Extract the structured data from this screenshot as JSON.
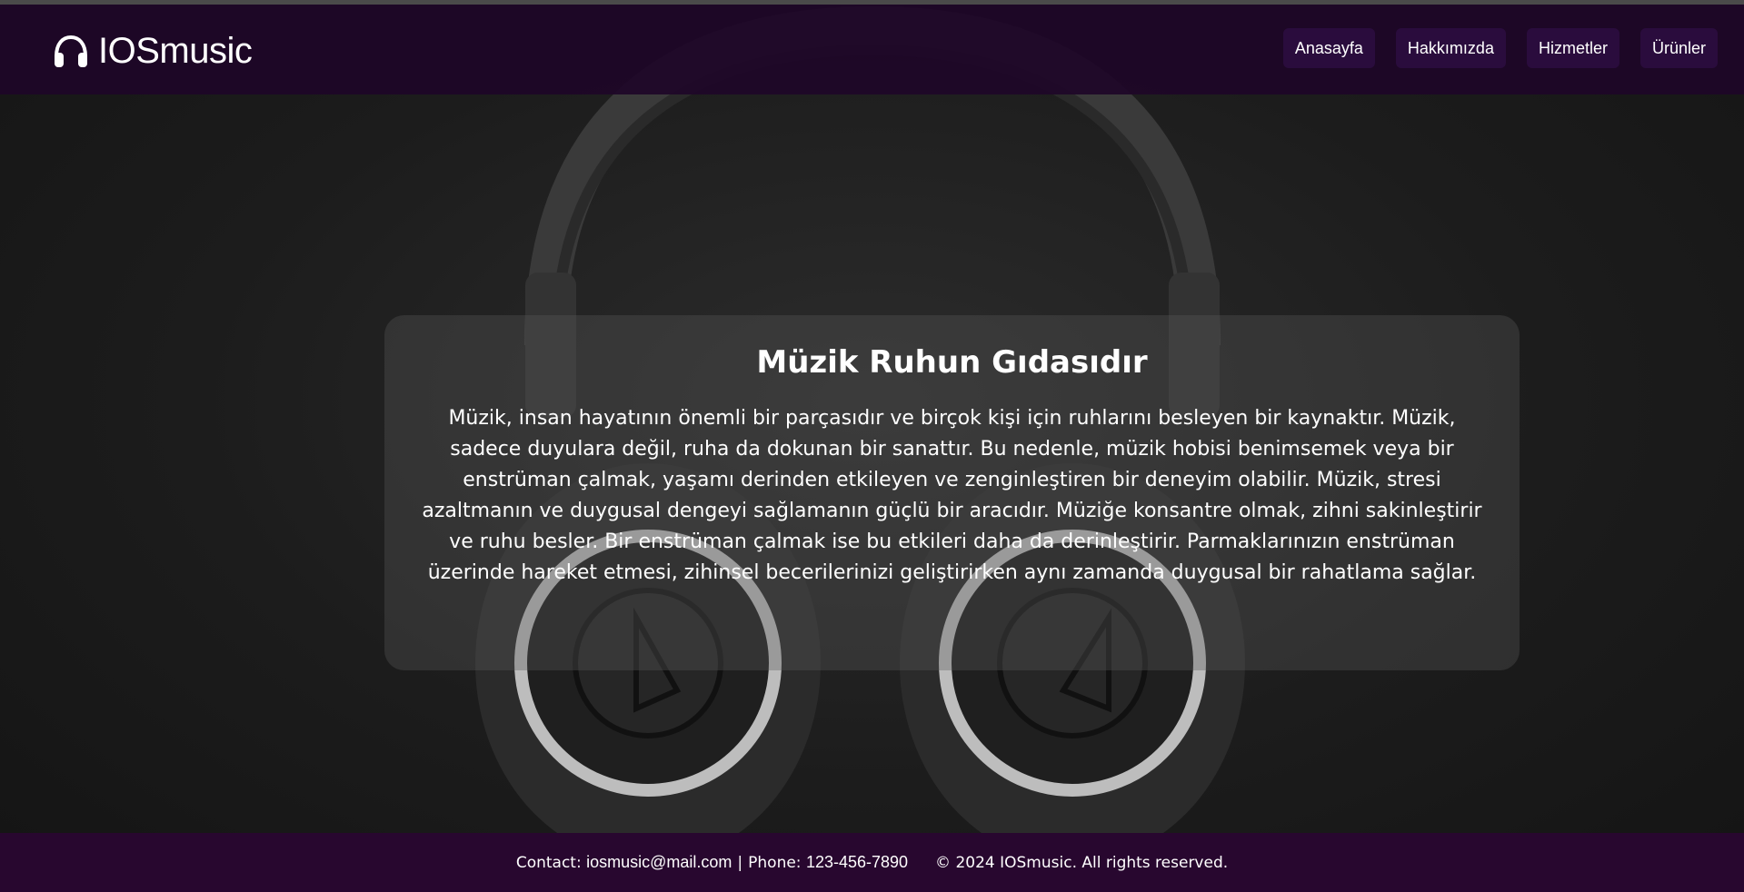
{
  "header": {
    "logo_text": "IOSmusic",
    "logo_icon": "headphones-icon",
    "nav": [
      {
        "label": "Anasayfa"
      },
      {
        "label": "Hakkımızda"
      },
      {
        "label": "Hizmetler"
      },
      {
        "label": "Ürünler"
      }
    ]
  },
  "hero": {
    "title": "Müzik Ruhun Gıdasıdır",
    "body": "Müzik, insan hayatının önemli bir parçasıdır ve birçok kişi için ruhlarını besleyen bir kaynaktır. Müzik, sadece duyulara değil, ruha da dokunan bir sanattır. Bu nedenle, müzik hobisi benimsemek veya bir enstrüman çalmak, yaşamı derinden etkileyen ve zenginleştiren bir deneyim olabilir. Müzik, stresi azaltmanın ve duygusal dengeyi sağlamanın güçlü bir aracıdır. Müziğe konsantre olmak, zihni sakinleştirir ve ruhu besler. Bir enstrüman çalmak ise bu etkileri daha da derinleştirir. Parmaklarınızın enstrüman üzerinde hareket etmesi, zihinsel becerilerinizi geliştirirken aynı zamanda duygusal bir rahatlama sağlar."
  },
  "footer": {
    "contact_label": "Contact:",
    "email": "iosmusic@mail.com",
    "separator": "|",
    "phone_label": "Phone:",
    "phone": "123-456-7890",
    "copyright": "© 2024 IOSmusic. All rights reserved."
  },
  "colors": {
    "header_bg": "#1e0628",
    "nav_bg": "#2a0c3d",
    "footer_bg": "#28072f"
  }
}
